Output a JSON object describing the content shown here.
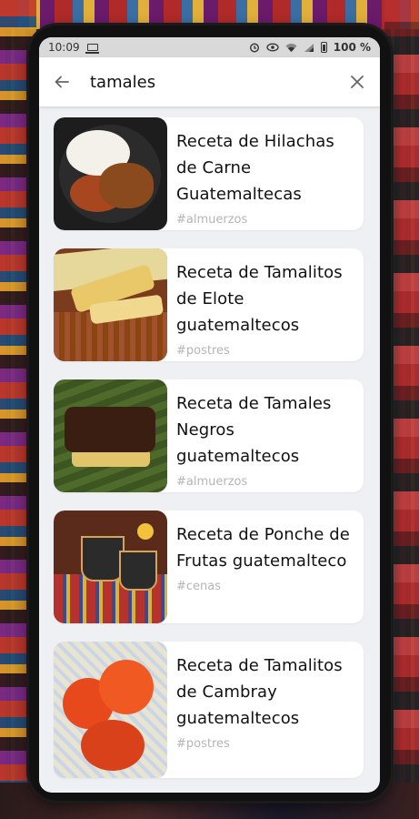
{
  "status_bar": {
    "time": "10:09",
    "battery": "100 %"
  },
  "search": {
    "query": "tamales"
  },
  "results": [
    {
      "title": "Receta de Hilachas de Carne Guatemaltecas",
      "tag": "#almuerzos",
      "image": "hilachas-plate"
    },
    {
      "title": "Receta de Tamalitos de Elote guatemaltecos",
      "tag": "#postres",
      "image": "tamalitos-elote"
    },
    {
      "title": "Receta de Tamales Negros guatemaltecos",
      "tag": "#almuerzos",
      "image": "tamales-negros"
    },
    {
      "title": "Receta de Ponche de Frutas guatemalteco",
      "tag": "#cenas",
      "image": "ponche-frutas"
    },
    {
      "title": "Receta de Tamalitos de Cambray guatemaltecos",
      "tag": "#postres",
      "image": "tamalitos-cambray"
    }
  ]
}
